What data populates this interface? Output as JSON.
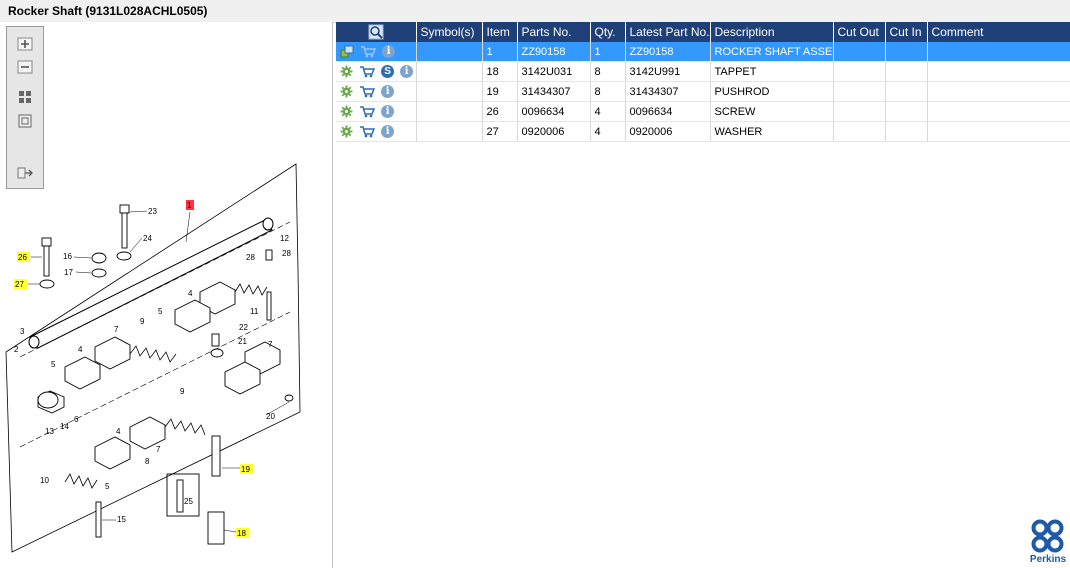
{
  "window": {
    "title": "Rocker Shaft (9131L028ACHL0505)"
  },
  "toolbar": {
    "buttons": [
      {
        "name": "zoom-in-button",
        "icon": "zoom-in-icon"
      },
      {
        "name": "zoom-out-button",
        "icon": "zoom-out-icon"
      },
      {
        "name": "fit-page-button",
        "icon": "fit-page-icon"
      },
      {
        "name": "actual-size-button",
        "icon": "actual-size-icon"
      },
      {
        "name": "export-button",
        "icon": "export-icon"
      }
    ]
  },
  "diagram": {
    "callouts": [
      "1",
      "2",
      "3",
      "4",
      "4",
      "4",
      "5",
      "5",
      "5",
      "6",
      "7",
      "7",
      "7",
      "7",
      "8",
      "9",
      "9",
      "10",
      "11",
      "12",
      "13",
      "14",
      "15",
      "16",
      "17",
      "18",
      "19",
      "20",
      "21",
      "22",
      "23",
      "24",
      "25",
      "26",
      "27",
      "28",
      "28"
    ],
    "highlighted_callouts": [
      "26",
      "27",
      "19",
      "18"
    ],
    "selected_callout": "1"
  },
  "table": {
    "columns": [
      "",
      "Symbol(s)",
      "Item",
      "Parts No.",
      "Qty.",
      "Latest Part No.",
      "Description",
      "Cut Out",
      "Cut In",
      "Comment"
    ],
    "rows": [
      {
        "symbols": [
          "assembly-icon",
          "cart-icon",
          "info-icon"
        ],
        "item": "1",
        "parts_no": "ZZ90158",
        "qty": "1",
        "latest_part_no": "ZZ90158",
        "description": "ROCKER SHAFT ASSEMB",
        "cut_out": "",
        "cut_in": "",
        "comment": "",
        "selected": true
      },
      {
        "symbols": [
          "gear-icon",
          "cart-icon",
          "s-icon",
          "info-icon"
        ],
        "item": "18",
        "parts_no": "3142U031",
        "qty": "8",
        "latest_part_no": "3142U991",
        "description": "TAPPET",
        "cut_out": "",
        "cut_in": "",
        "comment": "",
        "selected": false
      },
      {
        "symbols": [
          "gear-icon",
          "cart-icon",
          "info-icon"
        ],
        "item": "19",
        "parts_no": "31434307",
        "qty": "8",
        "latest_part_no": "31434307",
        "description": "PUSHROD",
        "cut_out": "",
        "cut_in": "",
        "comment": "",
        "selected": false
      },
      {
        "symbols": [
          "gear-icon",
          "cart-icon",
          "info-icon"
        ],
        "item": "26",
        "parts_no": "0096634",
        "qty": "4",
        "latest_part_no": "0096634",
        "description": "SCREW",
        "cut_out": "",
        "cut_in": "",
        "comment": "",
        "selected": false
      },
      {
        "symbols": [
          "gear-icon",
          "cart-icon",
          "info-icon"
        ],
        "item": "27",
        "parts_no": "0920006",
        "qty": "4",
        "latest_part_no": "0920006",
        "description": "WASHER",
        "cut_out": "",
        "cut_in": "",
        "comment": "",
        "selected": false
      }
    ]
  },
  "brand": {
    "name": "Perkins",
    "color": "#1f5aa6"
  },
  "colors": {
    "header": "#1f3f78",
    "selection": "#3399ff",
    "highlight": "#ffff33"
  }
}
